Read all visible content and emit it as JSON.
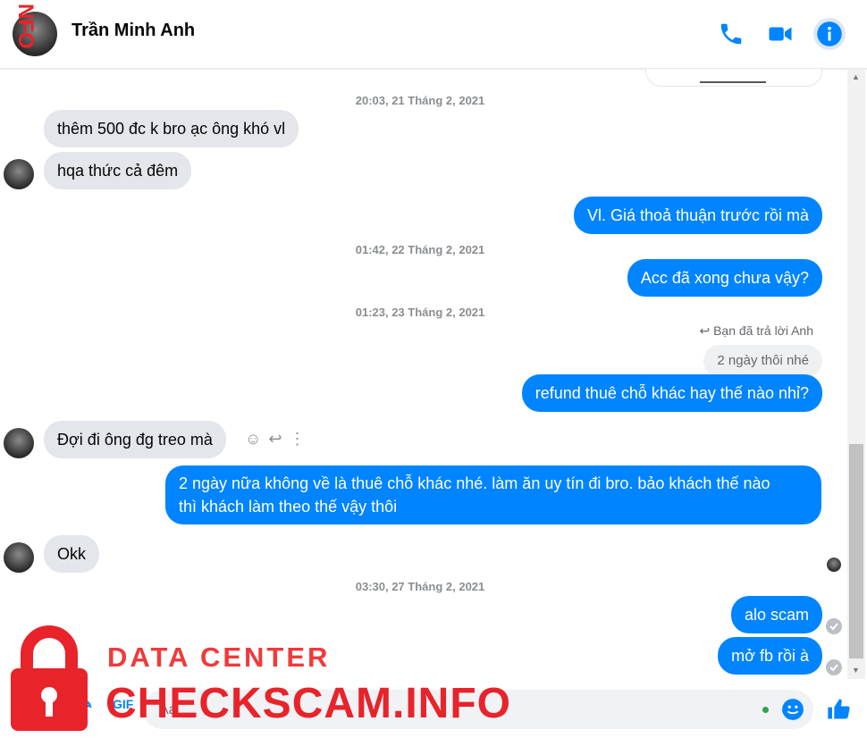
{
  "header": {
    "contact_name": "Trần Minh Anh",
    "icons": [
      "phone-icon",
      "video-call-icon",
      "info-icon"
    ]
  },
  "messages": {
    "ts1": "20:03, 21 Tháng 2, 2021",
    "in1": "thêm 500 đc k bro ạc ông khó vl",
    "in2": "hqa thức cả đêm",
    "out1": "Vl. Giá thoả thuận trước rồi mà",
    "ts2": "01:42, 22 Tháng 2, 2021",
    "out2": "Acc đã xong chưa vậy?",
    "ts3": "01:23, 23 Tháng 2, 2021",
    "reply_note": "Bạn đã trả lời Anh",
    "quoted": "2 ngày thôi nhé",
    "out3": "refund thuê chỗ khác hay thế nào nhỉ?",
    "in3": "Đợi đi ông đg treo mà",
    "out4_line1": "2 ngày nữa không về là thuê chỗ khác nhé. làm ăn uy tín đi bro. bảo khách thế nào",
    "out4_line2": "thì khách làm theo thế vậy thôi",
    "in4": "Okk",
    "ts4": "03:30, 27 Tháng 2, 2021",
    "out5": "alo scam",
    "out6": "mở fb rồi à"
  },
  "composer": {
    "placeholder": "Aa"
  },
  "watermark": {
    "side_text": "NFO",
    "data_center": "DATA CENTER",
    "brand": "CHECKSCAM.INFO"
  },
  "colors": {
    "accent": "#0084ff",
    "incoming_bubble": "#e4e6eb",
    "watermark_red": "#e8232a"
  }
}
